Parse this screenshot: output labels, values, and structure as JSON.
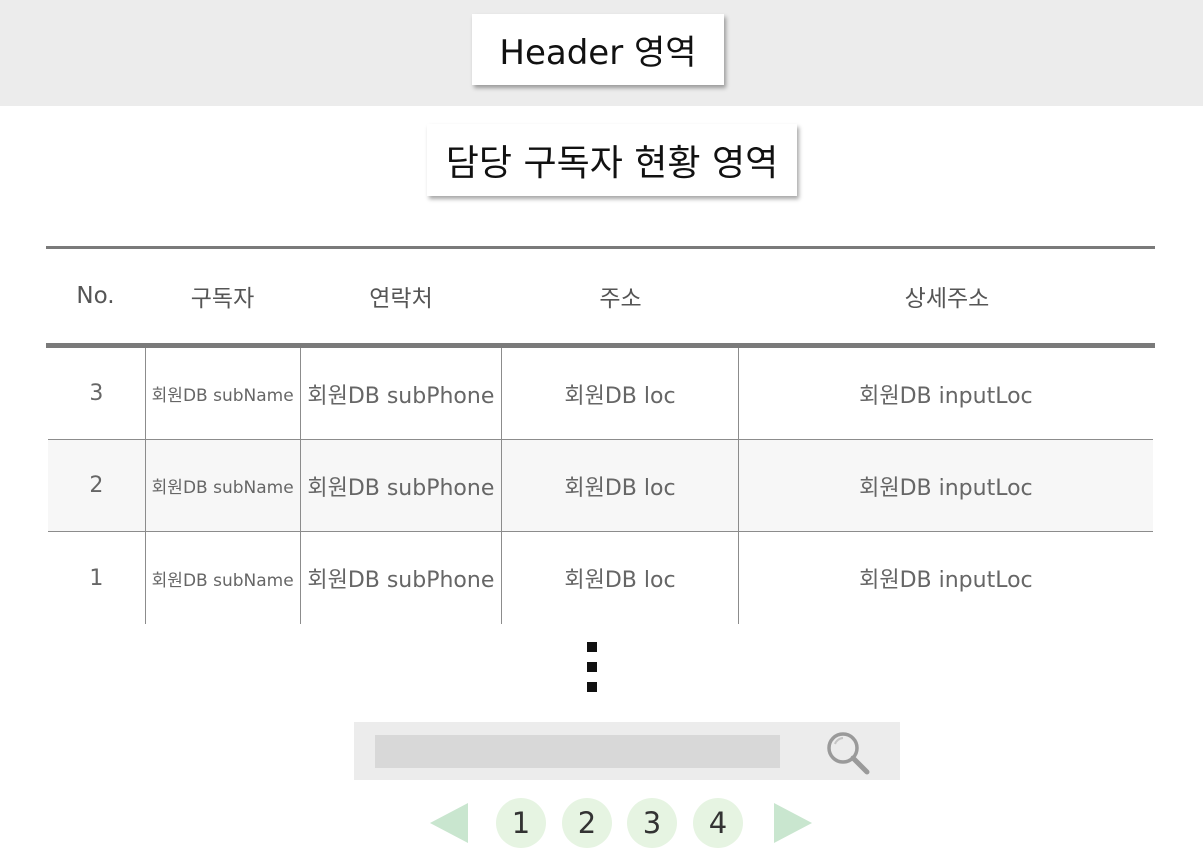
{
  "header": {
    "label": "Header 영역"
  },
  "section": {
    "title": "담당 구독자 현황 영역"
  },
  "table": {
    "columns": [
      "No.",
      "구독자",
      "연락처",
      "주소",
      "상세주소"
    ],
    "rows": [
      {
        "no": "3",
        "subscriber": "회원DB subName",
        "phone": "회원DB subPhone",
        "address": "회원DB loc",
        "detail": "회원DB inputLoc"
      },
      {
        "no": "2",
        "subscriber": "회원DB subName",
        "phone": "회원DB subPhone",
        "address": "회원DB loc",
        "detail": "회원DB inputLoc"
      },
      {
        "no": "1",
        "subscriber": "회원DB subName",
        "phone": "회원DB subPhone",
        "address": "회원DB loc",
        "detail": "회원DB inputLoc"
      }
    ]
  },
  "search": {
    "value": "",
    "icon": "search-icon"
  },
  "pagination": {
    "pages": [
      "1",
      "2",
      "3",
      "4"
    ],
    "prev_icon": "triangle-left-icon",
    "next_icon": "triangle-right-icon"
  },
  "colors": {
    "header_bg": "#ececec",
    "rule": "#7a7a7a",
    "page_circle": "#e6f4e2",
    "arrow": "#c9e6cf",
    "search_bar": "#ececec",
    "search_input": "#d8d8d8"
  }
}
